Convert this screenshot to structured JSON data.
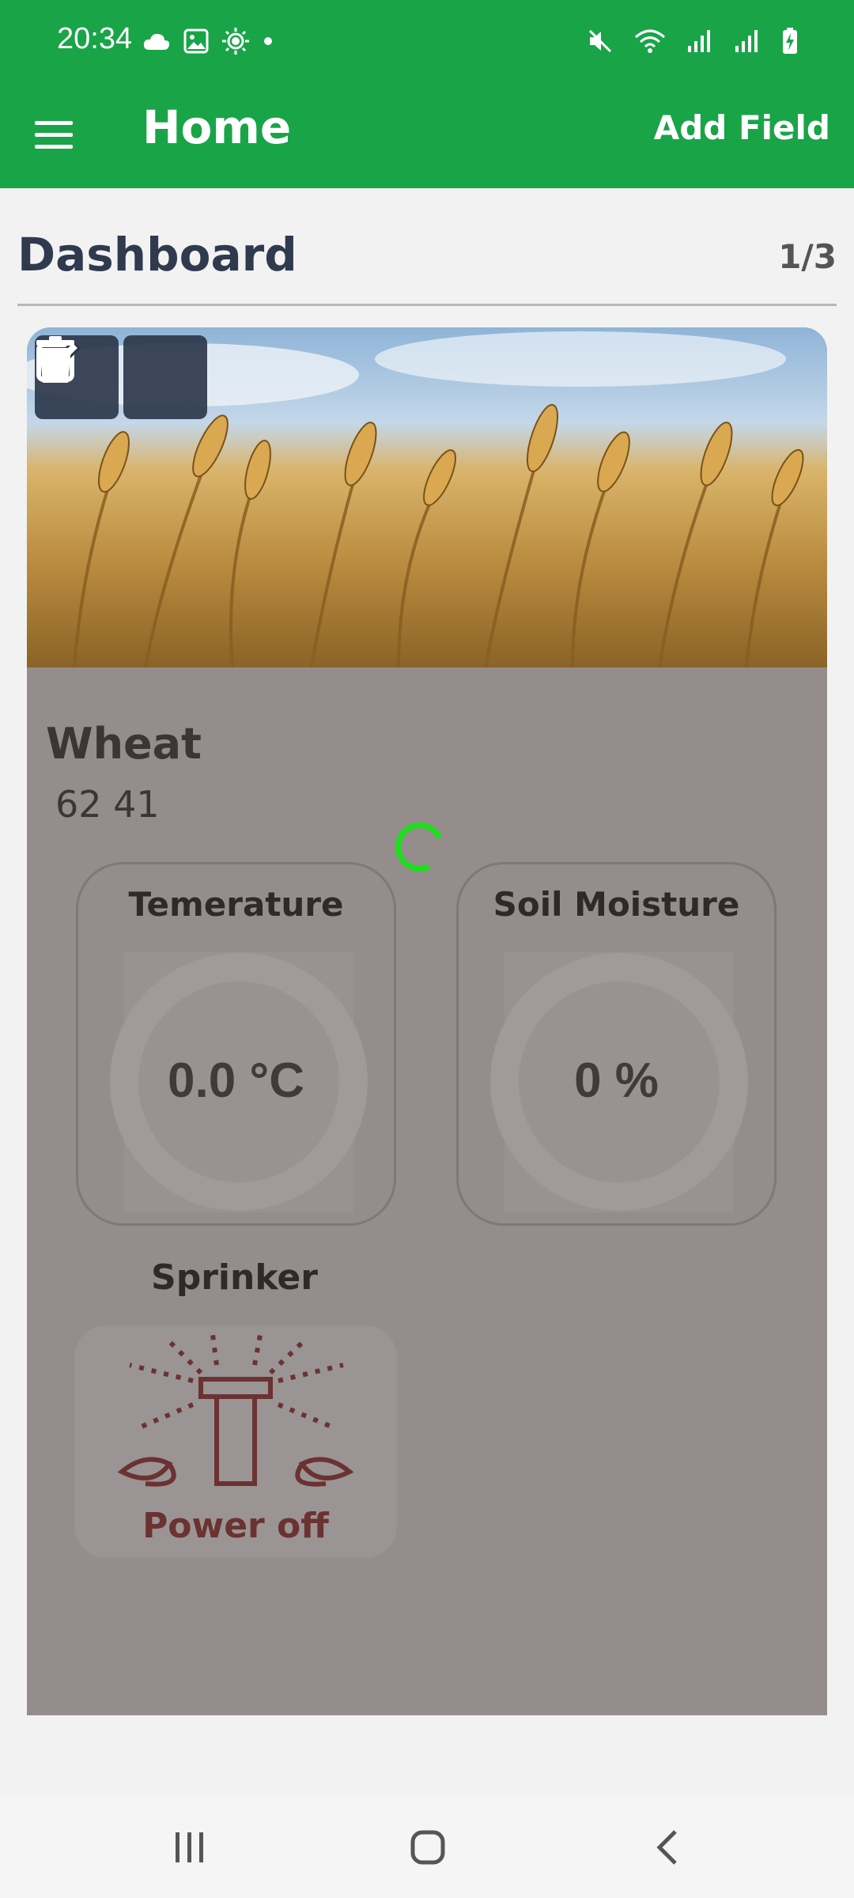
{
  "status_bar": {
    "time": "20:34",
    "left_icons": [
      "cloud-icon",
      "image-icon",
      "brightness-icon",
      "dot-icon"
    ],
    "right_icons": [
      "mute-icon",
      "wifi-icon",
      "signal-icon",
      "signal-icon",
      "battery-charging-icon"
    ]
  },
  "app_bar": {
    "title": "Home",
    "action_label": "Add Field",
    "menu_icon": "hamburger-menu-icon"
  },
  "dashboard": {
    "title": "Dashboard",
    "page_indicator": "1/3"
  },
  "field_card": {
    "image": "wheat-field-image",
    "name": "Wheat",
    "coords": "62 41",
    "actions": [
      "edit-icon",
      "trash-icon"
    ],
    "sensors": [
      {
        "title": "Temerature",
        "value": "0.0 °C"
      },
      {
        "title": "Soil Moisture",
        "value": "0  %"
      }
    ],
    "sprinkler": {
      "title": "Sprinker",
      "status": "Power off",
      "icon": "sprinkler-icon"
    }
  },
  "nav_bar": {
    "buttons": [
      "recents-icon",
      "home-icon",
      "back-icon"
    ]
  },
  "colors": {
    "primary": "#19a448",
    "overlay": "#958c8c",
    "spinner": "#19e019",
    "sprinkler_status": "#6b3232"
  }
}
